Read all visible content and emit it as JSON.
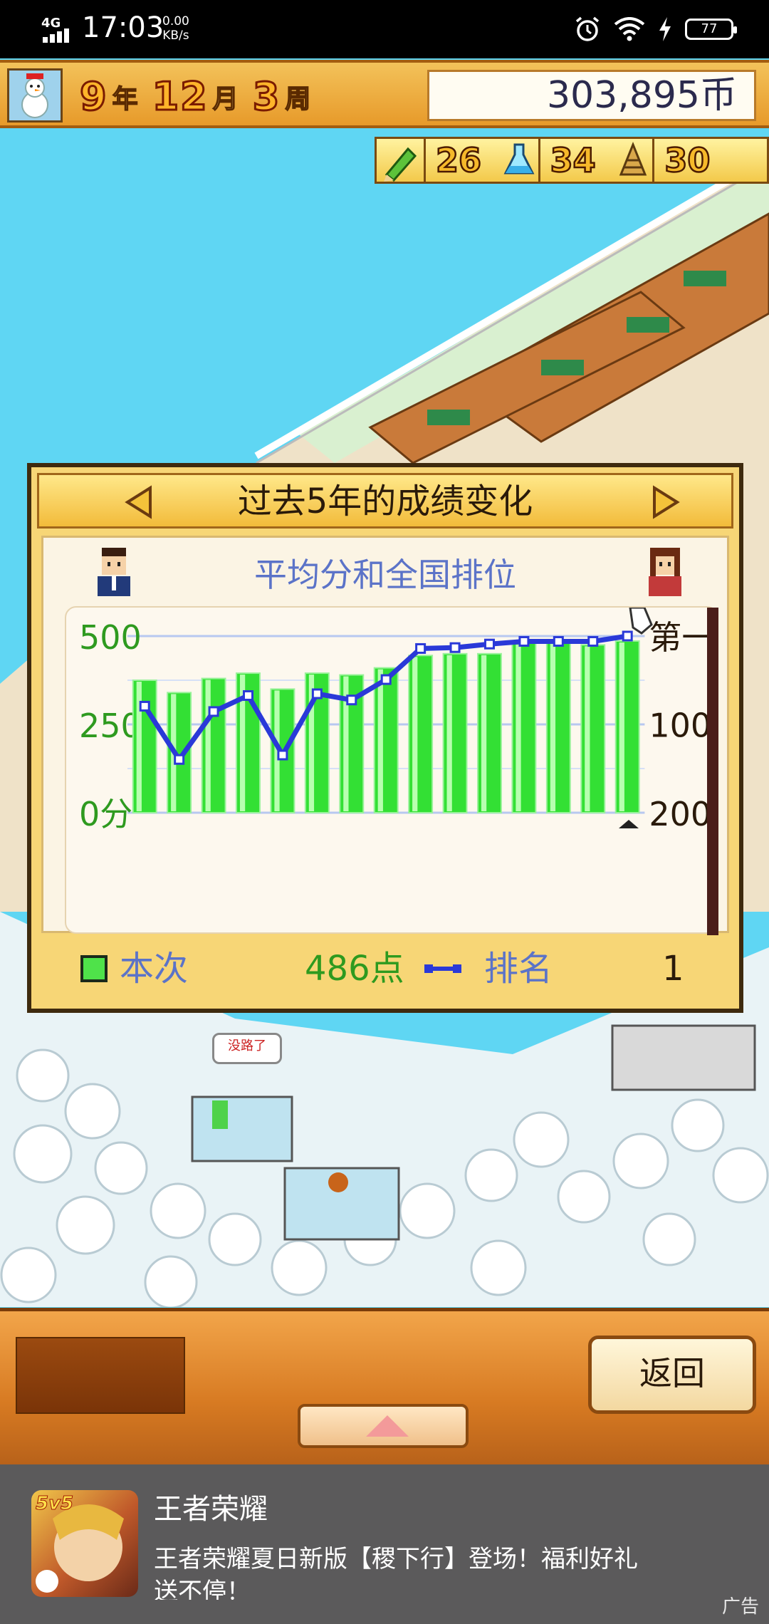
{
  "status_bar": {
    "network": "4G",
    "time": "17:03",
    "speed_value": "0.00",
    "speed_unit": "KB/s",
    "battery": "77",
    "icons": [
      "alarm-icon",
      "wifi-icon",
      "charging-icon",
      "battery-icon"
    ]
  },
  "hud": {
    "year": "9",
    "year_unit": "年",
    "month": "12",
    "month_unit": "月",
    "week": "3",
    "week_unit": "周",
    "money": "303,895币",
    "stats": [
      {
        "icon": "pencil-icon",
        "value": "26"
      },
      {
        "icon": "flask-icon",
        "value": "34"
      },
      {
        "icon": "cone-icon",
        "value": "30"
      }
    ]
  },
  "dialog": {
    "title": "过去5年的成绩变化",
    "subtitle": "平均分和全国排位",
    "legend": {
      "current_label": "本次",
      "current_value": "486点",
      "rank_label": "排名",
      "rank_value": "1"
    }
  },
  "chart_data": {
    "type": "bar",
    "title": "平均分和全国排位",
    "y_left": {
      "ticks": [
        "0分",
        "250",
        "500"
      ],
      "ylim": [
        0,
        500
      ]
    },
    "y_right": {
      "ticks": [
        "第一",
        "100",
        "200"
      ],
      "ylim": [
        1,
        200
      ],
      "inverted": true
    },
    "series": [
      {
        "name": "本次",
        "kind": "bar",
        "values": [
          375,
          340,
          380,
          395,
          350,
          395,
          390,
          410,
          445,
          450,
          450,
          480,
          490,
          475,
          486
        ]
      },
      {
        "name": "排名",
        "kind": "line",
        "values": [
          80,
          140,
          86,
          68,
          135,
          66,
          73,
          50,
          15,
          14,
          10,
          7,
          7,
          7,
          1
        ]
      }
    ],
    "grid": true
  },
  "bottom_panel": {
    "back_label": "返回"
  },
  "ad": {
    "title": "王者荣耀",
    "description": "王者荣耀夏日新版【稷下行】登场！福利好礼送不停！",
    "icon_badge": "5v5",
    "label": "广告"
  },
  "colors": {
    "bar_green": "#33e034",
    "rank_line": "#2a39d8",
    "left_axis_text": "#2e9a1f",
    "subtitle_blue": "#5b73c8"
  }
}
